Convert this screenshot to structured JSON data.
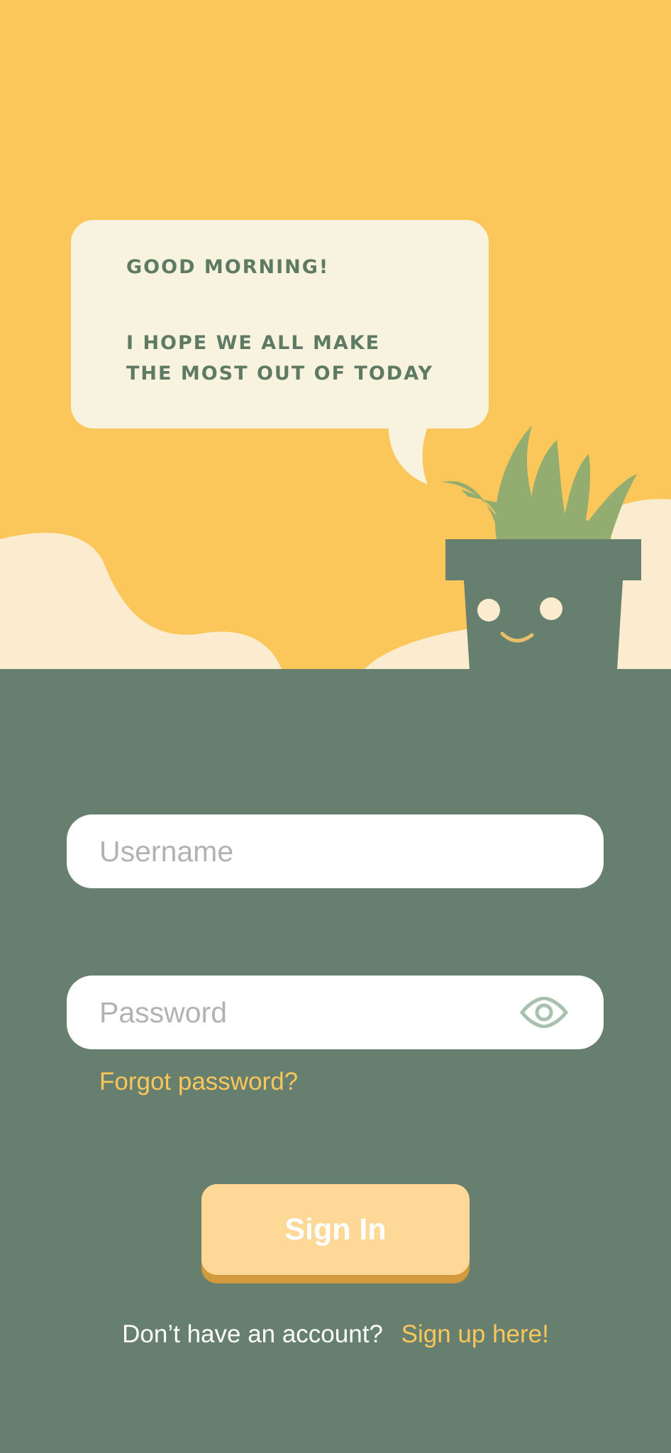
{
  "bubble": {
    "greeting": "GOOD MORNING!",
    "message_line1": "I HOPE WE ALL MAKE",
    "message_line2": "THE MOST OUT OF TODAY"
  },
  "form": {
    "username_placeholder": "Username",
    "username_value": "",
    "password_placeholder": "Password",
    "password_value": "",
    "password_toggle_icon": "eye-icon",
    "forgot_label": "Forgot password?",
    "signin_label": "Sign In",
    "no_account_text": "Don’t have an account?",
    "signup_link": "Sign up here!"
  },
  "colors": {
    "background_yellow": "#fbc65a",
    "panel_green": "#677f6e",
    "bubble": "#f7f3de",
    "cloud": "#fbebcf",
    "leaves": "#93ad70",
    "button": "#fdd896",
    "button_shadow": "#d39a3d",
    "link": "#fbc65a"
  }
}
